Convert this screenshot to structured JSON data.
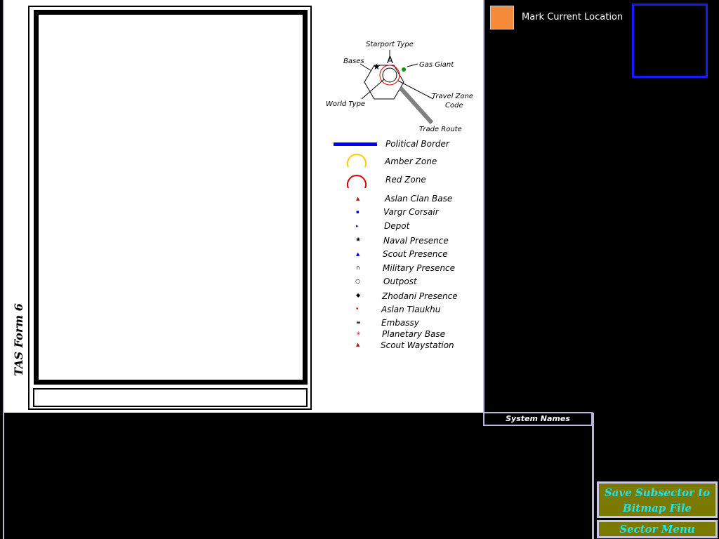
{
  "form": {
    "label": "TAS Form 6"
  },
  "hex_legend": {
    "starport_type": "Starport Type",
    "starport_letter": "A",
    "bases": "Bases",
    "gas_giant": "Gas Giant",
    "world_type": "World Type",
    "travel_zone_code_line1": "Travel Zone",
    "travel_zone_code_line2": "Code",
    "trade_route": "Trade Route"
  },
  "legend": [
    {
      "label": "Political Border"
    },
    {
      "label": "Amber Zone"
    },
    {
      "label": "Red Zone"
    },
    {
      "label": "Aslan Clan Base"
    },
    {
      "label": "Vargr Corsair"
    },
    {
      "label": "Depot"
    },
    {
      "label": "Naval Presence"
    },
    {
      "label": "Scout Presence"
    },
    {
      "label": "Military Presence"
    },
    {
      "label": "Outpost"
    },
    {
      "label": "Zhodani Presence"
    },
    {
      "label": "Aslan Tlaukhu"
    },
    {
      "label": "Embassy"
    },
    {
      "label": "Planetary Base"
    },
    {
      "label": "Scout Waystation"
    }
  ],
  "colors": {
    "political_border": "#0000ff",
    "amber_zone": "#ffcc00",
    "red_zone": "#dd0000",
    "current_location": "#f58a3a",
    "button_bg": "#7a7a00",
    "button_text": "#1ee6f0"
  },
  "toolbar": {
    "mark_location_label": "Mark Current Location",
    "system_names_label": "System Names",
    "save_label": "Save Subsector to Bitmap File",
    "sector_menu_label": "Sector Menu"
  }
}
